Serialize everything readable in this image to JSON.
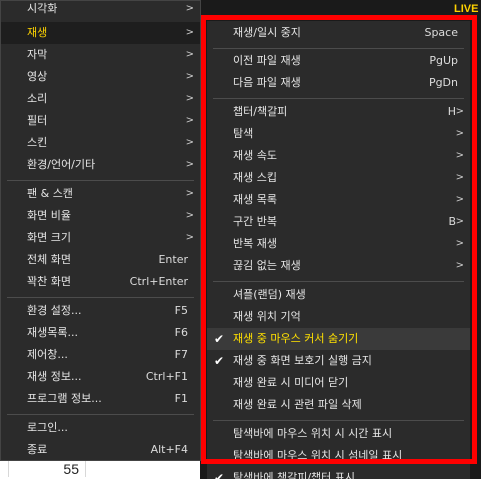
{
  "background": {
    "sheet_cell_value": "55",
    "live_label": "LIVE"
  },
  "main_menu": {
    "items": [
      {
        "label": "시각화",
        "shortcut": "",
        "arrow": ">"
      },
      {
        "label": "재생",
        "shortcut": "",
        "arrow": ">"
      },
      {
        "label": "자막",
        "shortcut": "",
        "arrow": ">"
      },
      {
        "label": "영상",
        "shortcut": "",
        "arrow": ">"
      },
      {
        "label": "소리",
        "shortcut": "",
        "arrow": ">"
      },
      {
        "label": "필터",
        "shortcut": "",
        "arrow": ">"
      },
      {
        "label": "스킨",
        "shortcut": "",
        "arrow": ">"
      },
      {
        "label": "환경/언어/기타",
        "shortcut": "",
        "arrow": ">"
      },
      {
        "label": "팬 & 스캔",
        "shortcut": "",
        "arrow": ">"
      },
      {
        "label": "화면 비율",
        "shortcut": "",
        "arrow": ">"
      },
      {
        "label": "화면 크기",
        "shortcut": "",
        "arrow": ">"
      },
      {
        "label": "전체 화면",
        "shortcut": "Enter",
        "arrow": ""
      },
      {
        "label": "꽉찬 화면",
        "shortcut": "Ctrl+Enter",
        "arrow": ""
      },
      {
        "label": "환경 설정...",
        "shortcut": "F5",
        "arrow": ""
      },
      {
        "label": "재생목록...",
        "shortcut": "F6",
        "arrow": ""
      },
      {
        "label": "제어창...",
        "shortcut": "F7",
        "arrow": ""
      },
      {
        "label": "재생 정보...",
        "shortcut": "Ctrl+F1",
        "arrow": ""
      },
      {
        "label": "프로그램 정보...",
        "shortcut": "F1",
        "arrow": ""
      },
      {
        "label": "로그인...",
        "shortcut": "",
        "arrow": ""
      },
      {
        "label": "종료",
        "shortcut": "Alt+F4",
        "arrow": ""
      }
    ],
    "selected_index": 1
  },
  "sub_menu": {
    "items": [
      {
        "label": "재생/일시 중지",
        "shortcut": "Space",
        "arrow": "",
        "checked": false
      },
      {
        "label": "이전 파일 재생",
        "shortcut": "PgUp",
        "arrow": "",
        "checked": false
      },
      {
        "label": "다음 파일 재생",
        "shortcut": "PgDn",
        "arrow": "",
        "checked": false
      },
      {
        "label": "챕터/책갈피",
        "shortcut": "H",
        "arrow": ">",
        "checked": false
      },
      {
        "label": "탐색",
        "shortcut": "",
        "arrow": ">",
        "checked": false
      },
      {
        "label": "재생 속도",
        "shortcut": "",
        "arrow": ">",
        "checked": false
      },
      {
        "label": "재생 스킵",
        "shortcut": "",
        "arrow": ">",
        "checked": false
      },
      {
        "label": "재생 목록",
        "shortcut": "",
        "arrow": ">",
        "checked": false
      },
      {
        "label": "구간 반복",
        "shortcut": "B",
        "arrow": ">",
        "checked": false
      },
      {
        "label": "반복 재생",
        "shortcut": "",
        "arrow": ">",
        "checked": false
      },
      {
        "label": "끊김 없는 재생",
        "shortcut": "",
        "arrow": ">",
        "checked": false
      },
      {
        "label": "셔플(랜덤) 재생",
        "shortcut": "",
        "arrow": "",
        "checked": false
      },
      {
        "label": "재생 위치 기억",
        "shortcut": "",
        "arrow": "",
        "checked": false
      },
      {
        "label": "재생 중 마우스 커서 숨기기",
        "shortcut": "",
        "arrow": "",
        "checked": true
      },
      {
        "label": "재생 중 화면 보호기 실행 금지",
        "shortcut": "",
        "arrow": "",
        "checked": true
      },
      {
        "label": "재생 완료 시 미디어 닫기",
        "shortcut": "",
        "arrow": "",
        "checked": false
      },
      {
        "label": "재생 완료 시 관련 파일 삭제",
        "shortcut": "",
        "arrow": "",
        "checked": false
      },
      {
        "label": "탐색바에 마우스 위치 시 시간 표시",
        "shortcut": "",
        "arrow": "",
        "checked": false
      },
      {
        "label": "탐색바에 마우스 위치 시 섬네일 표시",
        "shortcut": "",
        "arrow": "",
        "checked": false
      },
      {
        "label": "탐색바에 책갈피/챕터 표시",
        "shortcut": "",
        "arrow": "",
        "checked": true
      }
    ],
    "highlighted_index": 13
  },
  "colors": {
    "menu_bg": "#2b2b2b",
    "highlight_frame": "#ff0000",
    "active_text": "#ffd400"
  }
}
